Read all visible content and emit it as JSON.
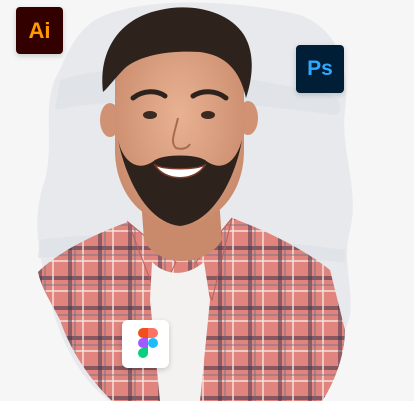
{
  "icons": {
    "illustrator": {
      "label": "Ai",
      "bg": "#330000",
      "fg": "#ff9a00",
      "icon": "adobe-illustrator-icon"
    },
    "photoshop": {
      "label": "Ps",
      "bg": "#001e36",
      "fg": "#31a8ff",
      "icon": "adobe-photoshop-icon"
    },
    "figma": {
      "icon": "figma-icon",
      "colors": [
        "#f24e1e",
        "#ff7262",
        "#a259ff",
        "#1abcfe",
        "#0acf83"
      ]
    }
  },
  "colors": {
    "background": "#f6f6f7",
    "brush_stroke": "#e4e6ea",
    "shirt": "#e2847e",
    "skin": "#dca383",
    "hair": "#2e231c"
  }
}
